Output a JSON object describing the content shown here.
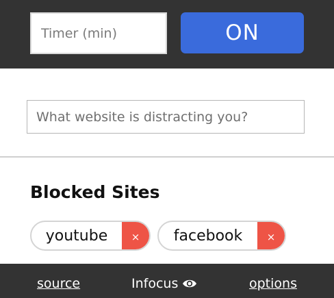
{
  "header": {
    "timer_placeholder": "Timer (min)",
    "toggle_label": "ON"
  },
  "site_input": {
    "placeholder": "What website is distracting you?"
  },
  "blocked": {
    "title": "Blocked Sites",
    "sites": [
      {
        "label": "youtube",
        "remove_label": "×"
      },
      {
        "label": "facebook",
        "remove_label": "×"
      }
    ]
  },
  "footer": {
    "source_label": "source",
    "brand_label": "Infocus",
    "brand_icon": "eye-icon",
    "options_label": "options"
  },
  "colors": {
    "bar": "#333333",
    "accent": "#3a6bdc",
    "remove": "#ee5446"
  }
}
